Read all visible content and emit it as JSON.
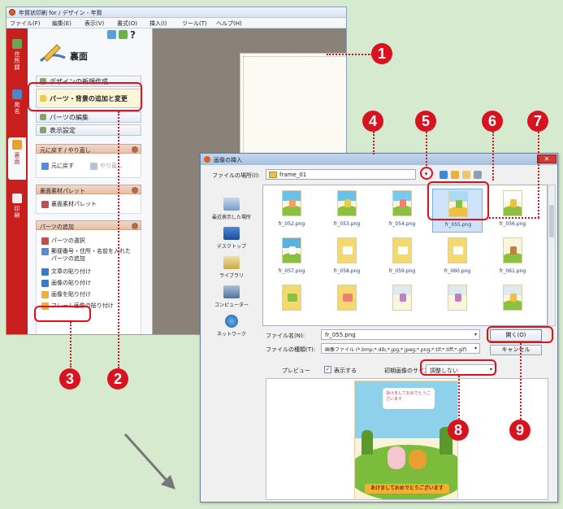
{
  "main_window": {
    "title": "年賀状印刷 for / デザイン - 年賀",
    "menu": [
      "ファイル(F)",
      "編集(E)",
      "表示(V)",
      "書式(O)",
      "挿入(I)",
      "ツール(T)",
      "ヘルプ(H)"
    ],
    "side_tabs": [
      "住所録",
      "宛名",
      "裏面",
      "印刷"
    ],
    "panel_title": "裏面",
    "panel_buttons": [
      "デザインの新規作成",
      "パーツ・背景の追加と変更",
      "パーツの編集",
      "表示設定"
    ],
    "undo_section": {
      "title": "元に戻す / やり直し",
      "undo": "元に戻す",
      "redo": "やり直し"
    },
    "palette_section": {
      "title": "裏面素材パレット",
      "item": "裏面素材パレット"
    },
    "parts_section": {
      "title": "パーツの追加",
      "items": [
        "パーツの選択",
        "郵便番号・住所・名前を入れたパーツの追加",
        "文章の貼り付け",
        "画像の貼り付け",
        "画像を貼り付け",
        "フレーム画像の貼り付け"
      ]
    }
  },
  "dialog": {
    "title": "画像の挿入",
    "look_in_label": "ファイルの場所(I):",
    "look_in_value": "frame_01",
    "places": [
      "最近表示した場所",
      "デスクトップ",
      "ライブラリ",
      "コンピューター",
      "ネットワーク"
    ],
    "files": [
      "fr_052.png",
      "fr_053.png",
      "fr_054.png",
      "fr_055.png",
      "fr_056.png",
      "fr_057.png",
      "fr_058.png",
      "fr_059.png",
      "fr_060.png",
      "fr_061.png",
      "",
      "",
      "",
      "",
      ""
    ],
    "filename_label": "ファイル名(N):",
    "filename_value": "fr_055.png",
    "filetype_label": "ファイルの種類(T):",
    "filetype_value": "画像ファイル (*.bmp;*.dib;*.jpg;*.jpeg;*.png;*.tif;*.tiff;*.gif)",
    "open_label": "開く(O)",
    "cancel_label": "キャンセル",
    "preview_label": "プレビュー",
    "show_label": "表示する",
    "show_checked": true,
    "size_label": "初期画像のサイズ調整",
    "size_value": "調整しない",
    "preview_banner": "あけましておめでとうございます",
    "preview_card_text": "あけましておめでとうございます"
  },
  "colors": {
    "highlight": "#e0101c",
    "marker": "#d8131f",
    "tab_strip": "#c81e1e",
    "background": "#d6ead0"
  },
  "markers": [
    "1",
    "2",
    "3",
    "4",
    "5",
    "6",
    "7",
    "8",
    "9"
  ]
}
